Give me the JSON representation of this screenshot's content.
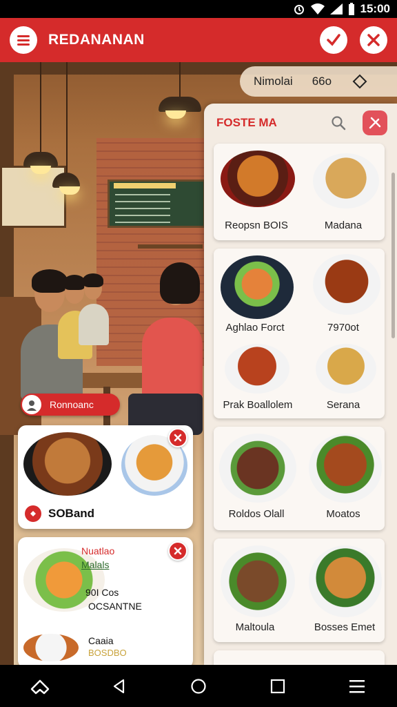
{
  "status": {
    "time": "15:00"
  },
  "app": {
    "title": "REDANANAN"
  },
  "top_links": {
    "link1": "Nimolai",
    "link2": "66o"
  },
  "suggestion_chip": {
    "label": "Ronnoanc"
  },
  "left_cards": {
    "card1": {
      "label": "SOBand"
    },
    "card2": {
      "title": "Nuatlao",
      "subtitle": "Malals",
      "detail_line1": "90I Cos",
      "detail_line2": "OCSANTNE",
      "footer_name": "Caaia",
      "footer_price": "BOSDBO"
    }
  },
  "panel": {
    "title": "FOSTE MA",
    "cards": [
      {
        "items": [
          "Reopsn BOIS",
          "Madana"
        ]
      },
      {
        "items": [
          "Aghlao Forct",
          "7970ot",
          "Prak Boallolem",
          "Serana"
        ]
      },
      {
        "items": [
          "Roldos Olall",
          "Moatos"
        ]
      },
      {
        "items": [
          "Maltoula",
          "Bosses Emet"
        ]
      }
    ]
  },
  "colors": {
    "brand_red": "#d52b2b",
    "panel_bg": "#f3ebe2"
  },
  "icons": [
    "alarm-icon",
    "wifi-icon",
    "signal-icon",
    "battery-icon",
    "menu-icon",
    "check-icon",
    "close-icon",
    "share-icon",
    "search-icon",
    "utensils-icon",
    "home-icon",
    "back-icon",
    "circle-home-icon",
    "recents-icon",
    "hamburger-icon"
  ]
}
